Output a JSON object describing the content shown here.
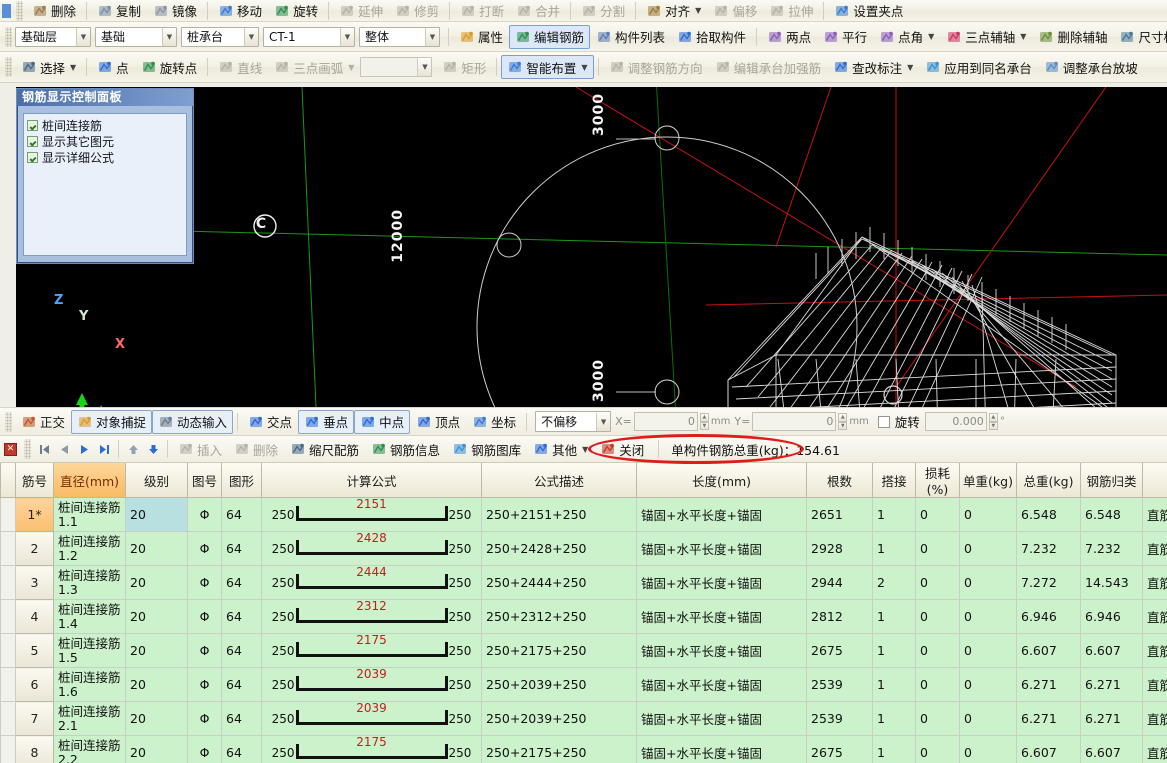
{
  "toolbar_row0": {
    "items": [
      {
        "label": "删除",
        "icon": "eraser-icon"
      },
      {
        "label": "复制",
        "icon": "copy-icon"
      },
      {
        "label": "镜像",
        "icon": "mirror-icon"
      },
      {
        "label": "移动",
        "icon": "move-icon"
      },
      {
        "label": "旋转",
        "icon": "rotate-icon"
      },
      {
        "label": "延伸",
        "icon": "extend-icon",
        "disabled": true
      },
      {
        "label": "修剪",
        "icon": "trim-icon",
        "disabled": true
      },
      {
        "label": "打断",
        "icon": "break-icon",
        "disabled": true
      },
      {
        "label": "合并",
        "icon": "merge-icon",
        "disabled": true
      },
      {
        "label": "分割",
        "icon": "split-icon",
        "disabled": true
      },
      {
        "label": "对齐",
        "icon": "align-icon",
        "caret": true
      },
      {
        "label": "偏移",
        "icon": "offset-icon",
        "disabled": true
      },
      {
        "label": "拉伸",
        "icon": "stretch-icon",
        "disabled": true
      },
      {
        "label": "设置夹点",
        "icon": "grip-point-icon"
      }
    ]
  },
  "toolbar_row1": {
    "combos": [
      {
        "name": "floor-select",
        "value": "基础层"
      },
      {
        "name": "category-select",
        "value": "基础"
      },
      {
        "name": "component-type-select",
        "value": "桩承台"
      },
      {
        "name": "component-select",
        "value": "CT-1"
      },
      {
        "name": "display-mode-select",
        "value": "整体"
      }
    ],
    "items": [
      {
        "label": "属性",
        "icon": "properties-icon"
      },
      {
        "label": "编辑钢筋",
        "icon": "edit-rebar-icon",
        "active": true
      },
      {
        "label": "构件列表",
        "icon": "component-list-icon"
      },
      {
        "label": "拾取构件",
        "icon": "pick-component-icon"
      },
      {
        "label": "两点",
        "icon": "two-point-axis-icon"
      },
      {
        "label": "平行",
        "icon": "parallel-axis-icon"
      },
      {
        "label": "点角",
        "icon": "point-angle-axis-icon",
        "caret": true
      },
      {
        "label": "三点辅轴",
        "icon": "three-point-axis-icon",
        "caret": true
      },
      {
        "label": "删除辅轴",
        "icon": "delete-axis-icon"
      },
      {
        "label": "尺寸标注",
        "icon": "dimension-icon",
        "caret": true
      }
    ]
  },
  "toolbar_row2": {
    "items": [
      {
        "label": "选择",
        "icon": "select-arrow-icon",
        "caret": true
      },
      {
        "label": "点",
        "icon": "point-icon"
      },
      {
        "label": "旋转点",
        "icon": "rotate-point-icon"
      },
      {
        "label": "直线",
        "icon": "line-icon",
        "disabled": true
      },
      {
        "label": "三点画弧",
        "icon": "three-point-arc-icon",
        "disabled": true,
        "caret": true
      },
      {
        "label": "矩形",
        "icon": "rectangle-icon",
        "disabled": true
      },
      {
        "label": "智能布置",
        "icon": "smart-layout-icon",
        "active": true,
        "caret": true
      },
      {
        "label": "调整钢筋方向",
        "icon": "adjust-rebar-direction-icon",
        "disabled": true
      },
      {
        "label": "编辑承台加强筋",
        "icon": "edit-cap-rebar-icon",
        "disabled": true
      },
      {
        "label": "查改标注",
        "icon": "check-annotation-icon",
        "caret": true
      },
      {
        "label": "应用到同名承台",
        "icon": "apply-same-cap-icon"
      },
      {
        "label": "调整承台放坡",
        "icon": "adjust-cap-slope-icon"
      }
    ],
    "arc_combo": {
      "name": "arc-style-select",
      "value": ""
    }
  },
  "control_panel": {
    "title": "钢筋显示控制面板",
    "checkboxes": [
      {
        "label": "桩间连接筋",
        "checked": true
      },
      {
        "label": "显示其它图元",
        "checked": true
      },
      {
        "label": "显示详细公式",
        "checked": true
      }
    ]
  },
  "viewport": {
    "axis_label_c": "C",
    "dim_12000": "12000",
    "dim_3000_top": "3000",
    "dim_3000_bottom": "3000",
    "gizmo": {
      "x": "X",
      "y": "Y",
      "z": "Z"
    }
  },
  "snapbar": {
    "items": [
      {
        "label": "正交",
        "icon": "ortho-icon"
      },
      {
        "label": "对象捕捉",
        "icon": "object-snap-icon",
        "active": true
      },
      {
        "label": "动态输入",
        "icon": "dynamic-input-icon",
        "active": true
      },
      {
        "label": "交点",
        "icon": "intersection-snap-icon"
      },
      {
        "label": "垂点",
        "icon": "perpendicular-snap-icon",
        "active": true
      },
      {
        "label": "中点",
        "icon": "midpoint-snap-icon",
        "active": true
      },
      {
        "label": "顶点",
        "icon": "vertex-snap-icon"
      },
      {
        "label": "坐标",
        "icon": "coordinate-snap-icon"
      }
    ],
    "offset_select": {
      "name": "offset-mode-select",
      "value": "不偏移"
    },
    "x_label": "X=",
    "x_value": "0",
    "x_unit": "mm",
    "y_label": "Y=",
    "y_value": "0",
    "y_unit": "mm",
    "rotate_label": "旋转",
    "rotate_value": "0.000",
    "rotate_unit": "°"
  },
  "rebar_toolbar": {
    "items": [
      {
        "label": "插入",
        "icon": "insert-row-icon",
        "disabled": true
      },
      {
        "label": "删除",
        "icon": "delete-row-icon",
        "disabled": true
      },
      {
        "label": "缩尺配筋",
        "icon": "scaled-rebar-icon"
      },
      {
        "label": "钢筋信息",
        "icon": "rebar-info-icon"
      },
      {
        "label": "钢筋图库",
        "icon": "rebar-library-icon"
      },
      {
        "label": "其他",
        "icon": "other-icon",
        "caret": true
      },
      {
        "label": "关闭",
        "icon": "close-icon"
      }
    ],
    "total_weight_label": "单构件钢筋总重(kg)：154.61",
    "nav": {
      "first": "first-record",
      "prev": "prev-record",
      "next": "next-record",
      "last": "last-record",
      "up": "move-up",
      "down": "move-down"
    },
    "highlight_color": "#e01b1b"
  },
  "table": {
    "columns": [
      {
        "key": "no",
        "label": ""
      },
      {
        "key": "name",
        "label": "筋号"
      },
      {
        "key": "diameter",
        "label": "直径(mm)",
        "highlight": true
      },
      {
        "key": "grade",
        "label": "级别"
      },
      {
        "key": "figure_no",
        "label": "图号"
      },
      {
        "key": "shape",
        "label": "图形"
      },
      {
        "key": "formula",
        "label": "计算公式"
      },
      {
        "key": "formula_desc",
        "label": "公式描述"
      },
      {
        "key": "length",
        "label": "长度(mm)"
      },
      {
        "key": "count",
        "label": "根数"
      },
      {
        "key": "lap",
        "label": "搭接"
      },
      {
        "key": "loss",
        "label": "损耗(%)"
      },
      {
        "key": "unit_weight",
        "label": "单重(kg)"
      },
      {
        "key": "total_weight",
        "label": "总重(kg)"
      },
      {
        "key": "classify",
        "label": "钢筋归类"
      }
    ],
    "rows": [
      {
        "no": "1*",
        "selected": true,
        "name": "桩间连接筋1.1",
        "diameter": "20",
        "grade": "Φ",
        "figure_no": "64",
        "shape_left": "250",
        "shape_mid": "2151",
        "shape_right": "250",
        "formula": "250+2151+250",
        "formula_desc": "锚固+水平长度+锚固",
        "length": "2651",
        "count": "1",
        "lap": "0",
        "loss": "0",
        "unit_weight": "6.548",
        "total_weight": "6.548",
        "classify": "直筋"
      },
      {
        "no": "2",
        "selected": false,
        "name": "桩间连接筋1.2",
        "diameter": "20",
        "grade": "Φ",
        "figure_no": "64",
        "shape_left": "250",
        "shape_mid": "2428",
        "shape_right": "250",
        "formula": "250+2428+250",
        "formula_desc": "锚固+水平长度+锚固",
        "length": "2928",
        "count": "1",
        "lap": "0",
        "loss": "0",
        "unit_weight": "7.232",
        "total_weight": "7.232",
        "classify": "直筋"
      },
      {
        "no": "3",
        "selected": false,
        "name": "桩间连接筋1.3",
        "diameter": "20",
        "grade": "Φ",
        "figure_no": "64",
        "shape_left": "250",
        "shape_mid": "2444",
        "shape_right": "250",
        "formula": "250+2444+250",
        "formula_desc": "锚固+水平长度+锚固",
        "length": "2944",
        "count": "2",
        "lap": "0",
        "loss": "0",
        "unit_weight": "7.272",
        "total_weight": "14.543",
        "classify": "直筋"
      },
      {
        "no": "4",
        "selected": false,
        "name": "桩间连接筋1.4",
        "diameter": "20",
        "grade": "Φ",
        "figure_no": "64",
        "shape_left": "250",
        "shape_mid": "2312",
        "shape_right": "250",
        "formula": "250+2312+250",
        "formula_desc": "锚固+水平长度+锚固",
        "length": "2812",
        "count": "1",
        "lap": "0",
        "loss": "0",
        "unit_weight": "6.946",
        "total_weight": "6.946",
        "classify": "直筋"
      },
      {
        "no": "5",
        "selected": false,
        "name": "桩间连接筋1.5",
        "diameter": "20",
        "grade": "Φ",
        "figure_no": "64",
        "shape_left": "250",
        "shape_mid": "2175",
        "shape_right": "250",
        "formula": "250+2175+250",
        "formula_desc": "锚固+水平长度+锚固",
        "length": "2675",
        "count": "1",
        "lap": "0",
        "loss": "0",
        "unit_weight": "6.607",
        "total_weight": "6.607",
        "classify": "直筋"
      },
      {
        "no": "6",
        "selected": false,
        "name": "桩间连接筋1.6",
        "diameter": "20",
        "grade": "Φ",
        "figure_no": "64",
        "shape_left": "250",
        "shape_mid": "2039",
        "shape_right": "250",
        "formula": "250+2039+250",
        "formula_desc": "锚固+水平长度+锚固",
        "length": "2539",
        "count": "1",
        "lap": "0",
        "loss": "0",
        "unit_weight": "6.271",
        "total_weight": "6.271",
        "classify": "直筋"
      },
      {
        "no": "7",
        "selected": false,
        "name": "桩间连接筋2.1",
        "diameter": "20",
        "grade": "Φ",
        "figure_no": "64",
        "shape_left": "250",
        "shape_mid": "2039",
        "shape_right": "250",
        "formula": "250+2039+250",
        "formula_desc": "锚固+水平长度+锚固",
        "length": "2539",
        "count": "1",
        "lap": "0",
        "loss": "0",
        "unit_weight": "6.271",
        "total_weight": "6.271",
        "classify": "直筋"
      },
      {
        "no": "8",
        "selected": false,
        "name": "桩间连接筋2.2",
        "diameter": "20",
        "grade": "Φ",
        "figure_no": "64",
        "shape_left": "250",
        "shape_mid": "2175",
        "shape_right": "250",
        "formula": "250+2175+250",
        "formula_desc": "锚固+水平长度+锚固",
        "length": "2675",
        "count": "1",
        "lap": "0",
        "loss": "0",
        "unit_weight": "6.607",
        "total_weight": "6.607",
        "classify": "直筋"
      }
    ]
  }
}
